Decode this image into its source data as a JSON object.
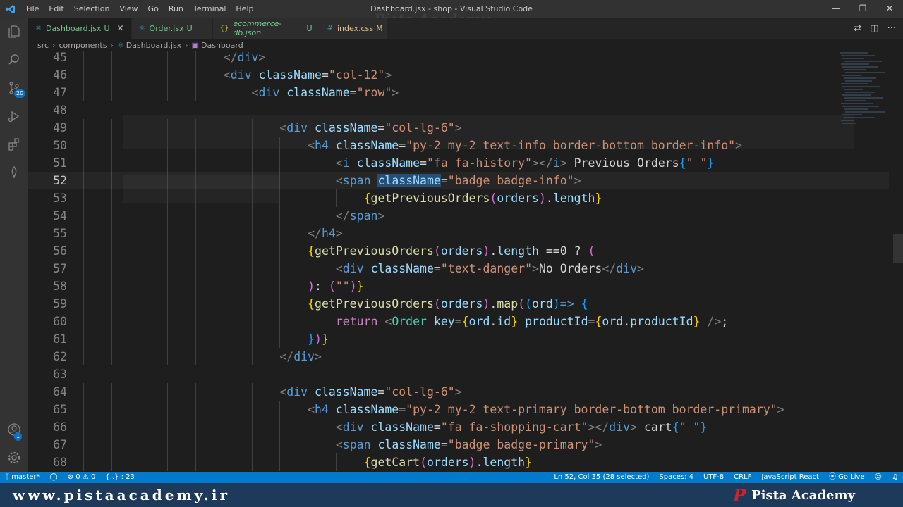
{
  "window": {
    "title": "Dashboard.jsx - shop - Visual Studio Code",
    "menus": [
      "File",
      "Edit",
      "Selection",
      "View",
      "Go",
      "Run",
      "Terminal",
      "Help"
    ],
    "watermark": "Pista Academy"
  },
  "activity_bar": {
    "icons": [
      "explorer-icon",
      "search-icon",
      "source-control-icon",
      "run-debug-icon",
      "extensions-icon",
      "mongodb-icon",
      "account-icon",
      "settings-gear-icon"
    ],
    "source_control_badge": "20",
    "account_badge": "1"
  },
  "tabs": [
    {
      "label": "Dashboard.jsx",
      "status": "U",
      "icon": "react-icon",
      "active": true,
      "close": "✕"
    },
    {
      "label": "Order.jsx",
      "status": "U",
      "icon": "react-icon",
      "active": false
    },
    {
      "label": "ecommerce-db.json",
      "status": "U",
      "icon": "json-icon",
      "active": false
    },
    {
      "label": "index.css",
      "status": "M",
      "icon": "css-icon",
      "active": false
    }
  ],
  "breadcrumb": [
    "src",
    "components",
    "Dashboard.jsx",
    "Dashboard"
  ],
  "editor": {
    "current_line": 52,
    "lines": [
      {
        "n": "45",
        "tokens": [
          [
            "br",
            "</"
          ],
          [
            "tag",
            "div"
          ],
          [
            "br",
            ">"
          ]
        ],
        "indent": 20
      },
      {
        "n": "46",
        "tokens": [
          [
            "br",
            "<"
          ],
          [
            "tag",
            "div"
          ],
          [
            "txt",
            " "
          ],
          [
            "attr",
            "className"
          ],
          [
            "txt",
            "="
          ],
          [
            "str",
            "\"col-12\""
          ],
          [
            "br",
            ">"
          ]
        ],
        "indent": 20
      },
      {
        "n": "47",
        "tokens": [
          [
            "br",
            "<"
          ],
          [
            "tag",
            "div"
          ],
          [
            "txt",
            " "
          ],
          [
            "attr",
            "className"
          ],
          [
            "txt",
            "="
          ],
          [
            "str",
            "\"row\""
          ],
          [
            "br",
            ">"
          ]
        ],
        "indent": 24
      },
      {
        "n": "48",
        "tokens": [],
        "indent": 0
      },
      {
        "n": "49",
        "tokens": [
          [
            "br",
            "<"
          ],
          [
            "tag",
            "div"
          ],
          [
            "txt",
            " "
          ],
          [
            "attr",
            "className"
          ],
          [
            "txt",
            "="
          ],
          [
            "str",
            "\"col-lg-6\""
          ],
          [
            "br",
            ">"
          ]
        ],
        "indent": 28
      },
      {
        "n": "50",
        "tokens": [
          [
            "br",
            "<"
          ],
          [
            "tag",
            "h4"
          ],
          [
            "txt",
            " "
          ],
          [
            "attr",
            "className"
          ],
          [
            "txt",
            "="
          ],
          [
            "str",
            "\"py-2 my-2 text-info border-bottom border-info\""
          ],
          [
            "br",
            ">"
          ]
        ],
        "indent": 32
      },
      {
        "n": "51",
        "tokens": [
          [
            "br",
            "<"
          ],
          [
            "tag",
            "i"
          ],
          [
            "txt",
            " "
          ],
          [
            "attr",
            "className"
          ],
          [
            "txt",
            "="
          ],
          [
            "str",
            "\"fa fa-history\""
          ],
          [
            "br",
            "></"
          ],
          [
            "tag",
            "i"
          ],
          [
            "br",
            ">"
          ],
          [
            "txt",
            " Previous Orders"
          ],
          [
            "p3",
            "{"
          ],
          [
            "str",
            "\" \""
          ],
          [
            "p3",
            "}"
          ]
        ],
        "indent": 36
      },
      {
        "n": "52",
        "tokens": [
          [
            "br",
            "<"
          ],
          [
            "tag",
            "span"
          ],
          [
            "txt",
            " "
          ],
          [
            "attrsel",
            "className"
          ],
          [
            "txt",
            "="
          ],
          [
            "str",
            "\"badge badge-info\""
          ],
          [
            "br",
            ">"
          ]
        ],
        "indent": 36
      },
      {
        "n": "53",
        "tokens": [
          [
            "p1",
            "{"
          ],
          [
            "fn",
            "getPreviousOrders"
          ],
          [
            "p2",
            "("
          ],
          [
            "attr",
            "orders"
          ],
          [
            "p2",
            ")"
          ],
          [
            "txt",
            "."
          ],
          [
            "attr",
            "length"
          ],
          [
            "p1",
            "}"
          ]
        ],
        "indent": 40
      },
      {
        "n": "54",
        "tokens": [
          [
            "br",
            "</"
          ],
          [
            "tag",
            "span"
          ],
          [
            "br",
            ">"
          ]
        ],
        "indent": 36
      },
      {
        "n": "55",
        "tokens": [
          [
            "br",
            "</"
          ],
          [
            "tag",
            "h4"
          ],
          [
            "br",
            ">"
          ]
        ],
        "indent": 32
      },
      {
        "n": "56",
        "tokens": [
          [
            "p1",
            "{"
          ],
          [
            "fn",
            "getPreviousOrders"
          ],
          [
            "p2",
            "("
          ],
          [
            "attr",
            "orders"
          ],
          [
            "p2",
            ")"
          ],
          [
            "txt",
            "."
          ],
          [
            "attr",
            "length"
          ],
          [
            "txt",
            " ==0 ? "
          ],
          [
            "p2",
            "("
          ]
        ],
        "indent": 32
      },
      {
        "n": "57",
        "tokens": [
          [
            "br",
            "<"
          ],
          [
            "tag",
            "div"
          ],
          [
            "txt",
            " "
          ],
          [
            "attr",
            "className"
          ],
          [
            "txt",
            "="
          ],
          [
            "str",
            "\"text-danger\""
          ],
          [
            "br",
            ">"
          ],
          [
            "txt",
            "No Orders"
          ],
          [
            "br",
            "</"
          ],
          [
            "tag",
            "div"
          ],
          [
            "br",
            ">"
          ]
        ],
        "indent": 36
      },
      {
        "n": "58",
        "tokens": [
          [
            "p2",
            ")"
          ],
          [
            "txt",
            ": "
          ],
          [
            "p2",
            "("
          ],
          [
            "str",
            "\"\""
          ],
          [
            "p2",
            ")"
          ],
          [
            "p1",
            "}"
          ]
        ],
        "indent": 32
      },
      {
        "n": "59",
        "tokens": [
          [
            "p1",
            "{"
          ],
          [
            "fn",
            "getPreviousOrders"
          ],
          [
            "p2",
            "("
          ],
          [
            "attr",
            "orders"
          ],
          [
            "p2",
            ")"
          ],
          [
            "txt",
            "."
          ],
          [
            "fn",
            "map"
          ],
          [
            "p2",
            "("
          ],
          [
            "p3",
            "("
          ],
          [
            "attr",
            "ord"
          ],
          [
            "p3",
            ")"
          ],
          [
            "kwop",
            "=>"
          ],
          [
            "txt",
            " "
          ],
          [
            "p3",
            "{"
          ]
        ],
        "indent": 32
      },
      {
        "n": "60",
        "tokens": [
          [
            "kw",
            "return"
          ],
          [
            "txt",
            " "
          ],
          [
            "br",
            "<"
          ],
          [
            "comp",
            "Order"
          ],
          [
            "txt",
            " "
          ],
          [
            "attr",
            "key"
          ],
          [
            "txt",
            "="
          ],
          [
            "p1",
            "{"
          ],
          [
            "attr",
            "ord"
          ],
          [
            "txt",
            "."
          ],
          [
            "attr",
            "id"
          ],
          [
            "p1",
            "}"
          ],
          [
            "txt",
            " "
          ],
          [
            "attr",
            "productId"
          ],
          [
            "txt",
            "="
          ],
          [
            "p1",
            "{"
          ],
          [
            "attr",
            "ord"
          ],
          [
            "txt",
            "."
          ],
          [
            "attr",
            "productId"
          ],
          [
            "p1",
            "}"
          ],
          [
            "txt",
            " "
          ],
          [
            "br",
            "/>"
          ],
          [
            "txt",
            ";"
          ]
        ],
        "indent": 36
      },
      {
        "n": "61",
        "tokens": [
          [
            "p3",
            "}"
          ],
          [
            "p2",
            ")"
          ],
          [
            "p1",
            "}"
          ]
        ],
        "indent": 32
      },
      {
        "n": "62",
        "tokens": [
          [
            "br",
            "</"
          ],
          [
            "tag",
            "div"
          ],
          [
            "br",
            ">"
          ]
        ],
        "indent": 28
      },
      {
        "n": "63",
        "tokens": [],
        "indent": 0
      },
      {
        "n": "64",
        "tokens": [
          [
            "br",
            "<"
          ],
          [
            "tag",
            "div"
          ],
          [
            "txt",
            " "
          ],
          [
            "attr",
            "className"
          ],
          [
            "txt",
            "="
          ],
          [
            "str",
            "\"col-lg-6\""
          ],
          [
            "br",
            ">"
          ]
        ],
        "indent": 28
      },
      {
        "n": "65",
        "tokens": [
          [
            "br",
            "<"
          ],
          [
            "tag",
            "h4"
          ],
          [
            "txt",
            " "
          ],
          [
            "attr",
            "className"
          ],
          [
            "txt",
            "="
          ],
          [
            "str",
            "\"py-2 my-2 text-primary border-bottom border-primary\""
          ],
          [
            "br",
            ">"
          ]
        ],
        "indent": 32
      },
      {
        "n": "66",
        "tokens": [
          [
            "br",
            "<"
          ],
          [
            "tag",
            "div"
          ],
          [
            "txt",
            " "
          ],
          [
            "attr",
            "className"
          ],
          [
            "txt",
            "="
          ],
          [
            "str",
            "\"fa fa-shopping-cart\""
          ],
          [
            "br",
            "></"
          ],
          [
            "tag",
            "div"
          ],
          [
            "br",
            ">"
          ],
          [
            "txt",
            " cart"
          ],
          [
            "p3",
            "{"
          ],
          [
            "str",
            "\" \""
          ],
          [
            "p3",
            "}"
          ]
        ],
        "indent": 36
      },
      {
        "n": "67",
        "tokens": [
          [
            "br",
            "<"
          ],
          [
            "tag",
            "span"
          ],
          [
            "txt",
            " "
          ],
          [
            "attr",
            "className"
          ],
          [
            "txt",
            "="
          ],
          [
            "str",
            "\"badge badge-primary\""
          ],
          [
            "br",
            ">"
          ]
        ],
        "indent": 36
      },
      {
        "n": "68",
        "tokens": [
          [
            "p1",
            "{"
          ],
          [
            "fn",
            "getCart"
          ],
          [
            "p2",
            "("
          ],
          [
            "attr",
            "orders"
          ],
          [
            "p2",
            ")"
          ],
          [
            "txt",
            "."
          ],
          [
            "attr",
            "length"
          ],
          [
            "p1",
            "}"
          ]
        ],
        "indent": 40
      }
    ]
  },
  "statusbar": {
    "branch": "master*",
    "errors": "0",
    "warnings": "0",
    "selector": "{..} : 23",
    "position": "Ln 52, Col 35 (28 selected)",
    "spaces": "Spaces: 4",
    "encoding": "UTF-8",
    "eol": "CRLF",
    "language": "JavaScript React",
    "golive": "Go Live"
  },
  "footer": {
    "website": "www.pistaacademy.ir",
    "brand": "Pista Academy",
    "brand_logo": "P"
  },
  "colors": {
    "accent": "#007acc",
    "editor_bg": "#1e1e1e",
    "footer_bg": "#1e3a5a",
    "brand_red": "#d2232a"
  }
}
